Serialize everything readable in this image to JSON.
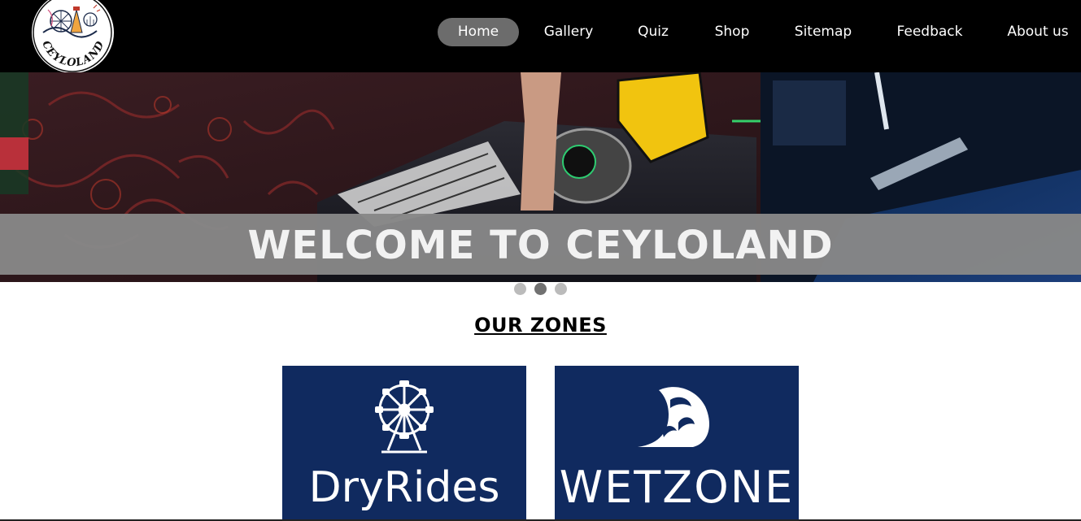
{
  "header": {
    "logo_text": "CEYLOLAND",
    "nav": [
      {
        "label": "Home",
        "active": true
      },
      {
        "label": "Gallery",
        "active": false
      },
      {
        "label": "Quiz",
        "active": false
      },
      {
        "label": "Shop",
        "active": false
      },
      {
        "label": "Sitemap",
        "active": false
      },
      {
        "label": "Feedback",
        "active": false
      },
      {
        "label": "About us",
        "active": false
      }
    ]
  },
  "hero": {
    "welcome": "WELCOME TO CEYLOLAND",
    "slides": 3,
    "active_slide": 2
  },
  "zones": {
    "title": "OUR ZONES",
    "cards": [
      {
        "label": "DryRides",
        "icon": "ferris-wheel-icon"
      },
      {
        "label": "WETZONE",
        "icon": "wave-icon"
      }
    ]
  },
  "colors": {
    "header_bg": "#000000",
    "nav_active": "#6c6c6c",
    "zone_card_bg": "#102a5f",
    "welcome_bar": "#878787"
  }
}
